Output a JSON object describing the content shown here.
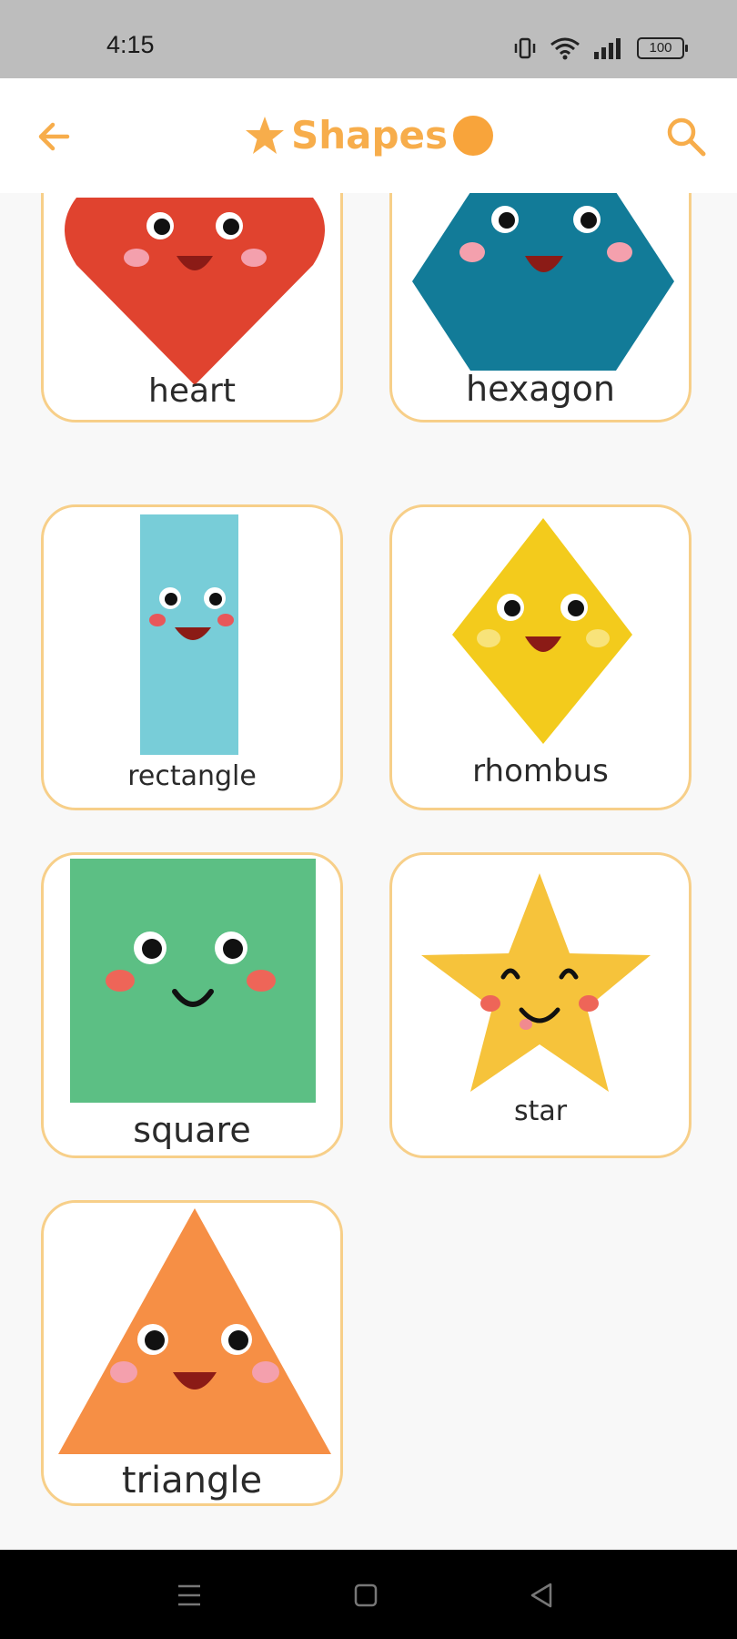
{
  "status_bar": {
    "time": "4:15",
    "battery": "100"
  },
  "app_bar": {
    "title": "Shapes",
    "back_icon": "arrow-left-icon",
    "search_icon": "search-icon",
    "accent": "#f7ad4b"
  },
  "shapes": [
    {
      "label": "heart",
      "color": "#e0432f"
    },
    {
      "label": "hexagon",
      "color": "#127b98"
    },
    {
      "label": "rectangle",
      "color": "#78cdd8"
    },
    {
      "label": "rhombus",
      "color": "#f3cb1c"
    },
    {
      "label": "square",
      "color": "#5cbf84"
    },
    {
      "label": "star",
      "color": "#f6c33b"
    },
    {
      "label": "triangle",
      "color": "#f68f45"
    }
  ],
  "nav_bar": {
    "items": [
      "menu-icon",
      "home-square-icon",
      "back-triangle-icon"
    ]
  }
}
